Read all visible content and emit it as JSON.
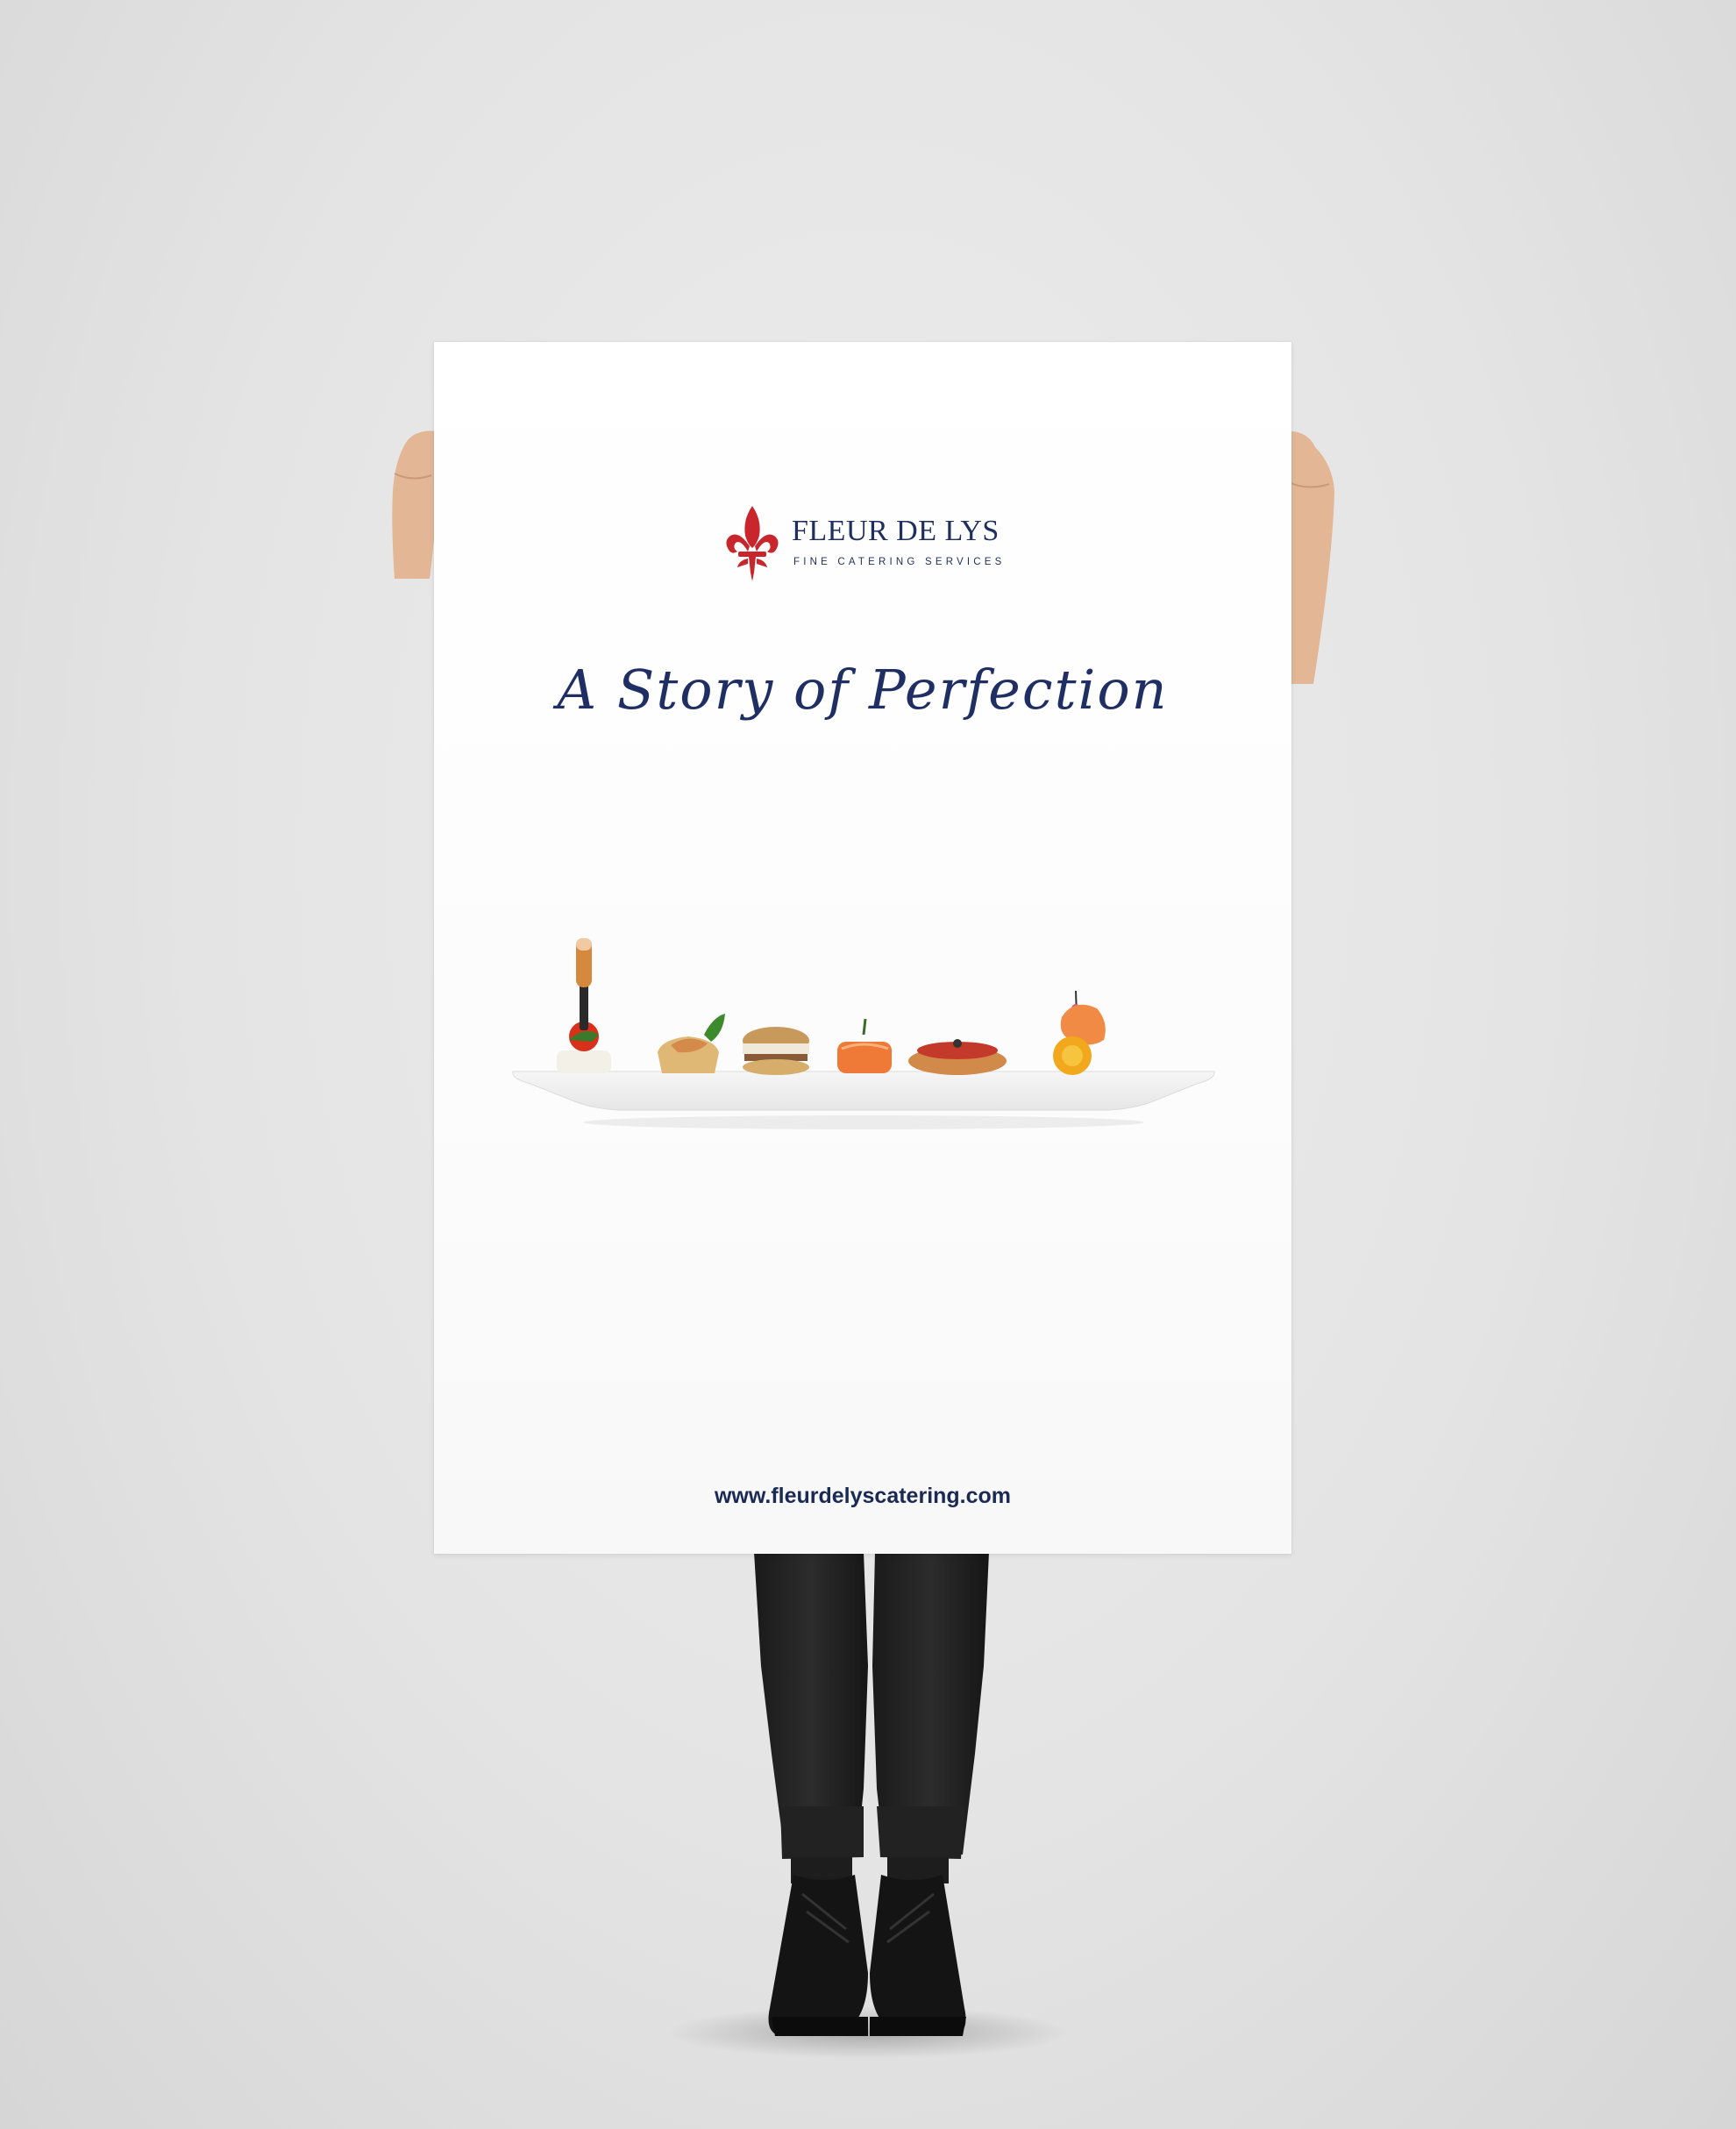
{
  "scene": {
    "description_icons": [
      "person-holding-poster",
      "hand-left-icon",
      "hand-right-icon",
      "black-shoes-icon"
    ]
  },
  "poster": {
    "logo": {
      "emblem_icon": "fleur-de-lis-icon",
      "name": "FLEUR DE LYS",
      "tagline": "FINE CATERING SERVICES",
      "emblem_color": "#c8262c",
      "text_color": "#1e2e5e"
    },
    "headline": "A Story of Perfection",
    "image": "canape-tray-photo",
    "website": "www.fleurdelyscatering.com"
  }
}
